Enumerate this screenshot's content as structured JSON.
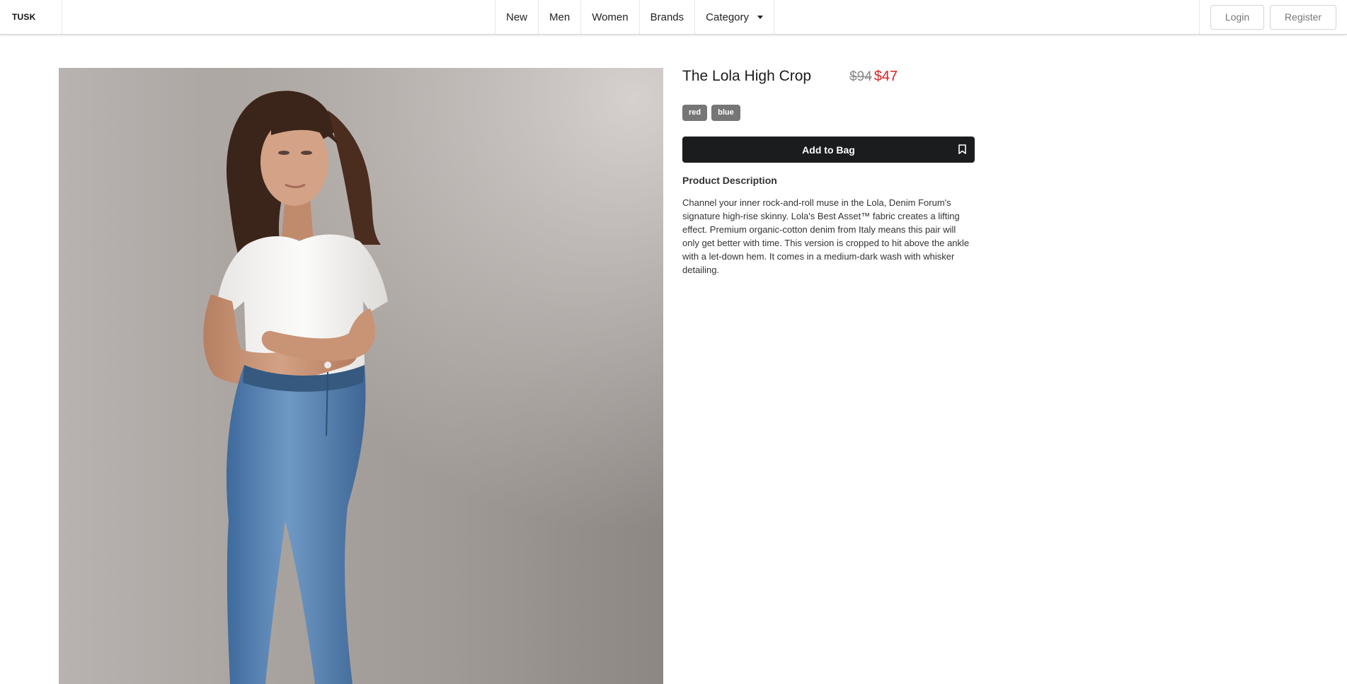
{
  "header": {
    "logo": "TUSK",
    "nav": [
      {
        "label": "New"
      },
      {
        "label": "Men"
      },
      {
        "label": "Women"
      },
      {
        "label": "Brands"
      },
      {
        "label": "Category"
      }
    ],
    "login_label": "Login",
    "register_label": "Register"
  },
  "product": {
    "title": "The Lola High Crop",
    "price_original": "$94",
    "price_sale": "$47",
    "colors": [
      "red",
      "blue"
    ],
    "add_to_bag_label": "Add to Bag",
    "description_heading": "Product Description",
    "description": "Channel your inner rock-and-roll muse in the Lola, Denim Forum's signature high-rise skinny. Lola's Best Asset™ fabric creates a lifting effect. Premium organic-cotton denim from Italy means this pair will only get better with time. This version is cropped to hit above the ankle with a let-down hem. It comes in a medium-dark wash with whisker detailing."
  },
  "icons": {
    "dropdown": "caret-down-icon",
    "bookmark": "bookmark-icon"
  },
  "colors": {
    "sale_price": "#e02020",
    "primary_button": "#1b1c1d",
    "tag_background": "#767676"
  }
}
